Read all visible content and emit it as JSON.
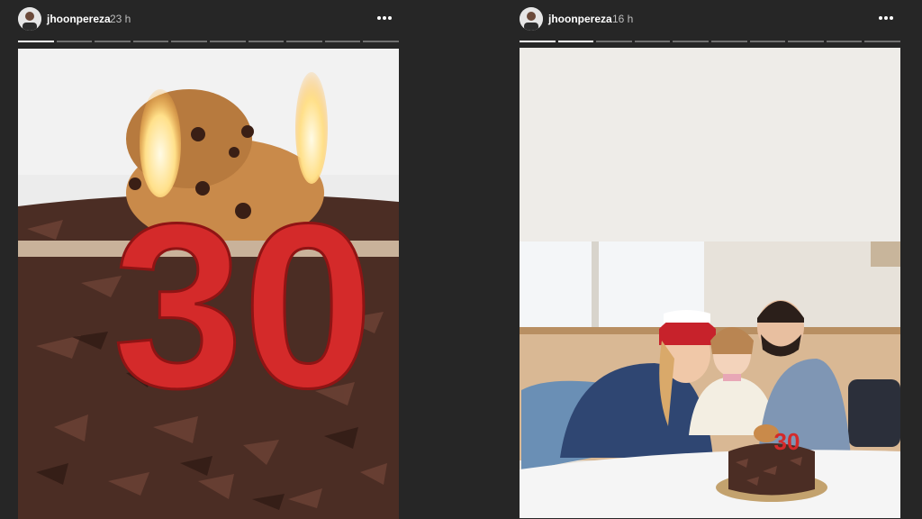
{
  "stories": [
    {
      "username": "jhoonpereza",
      "time": "23 h",
      "candle_number": "30",
      "progress_segments": 10,
      "progress_completed": 1
    },
    {
      "username": "jhoonpereza",
      "time": "16 h",
      "candle_number": "30",
      "progress_segments": 10,
      "progress_completed": 2
    }
  ],
  "colors": {
    "background": "#262626",
    "candle_red": "#d42a2a",
    "chocolate": "#4a2a20"
  },
  "icons": [
    "avatar",
    "more-options-icon"
  ]
}
